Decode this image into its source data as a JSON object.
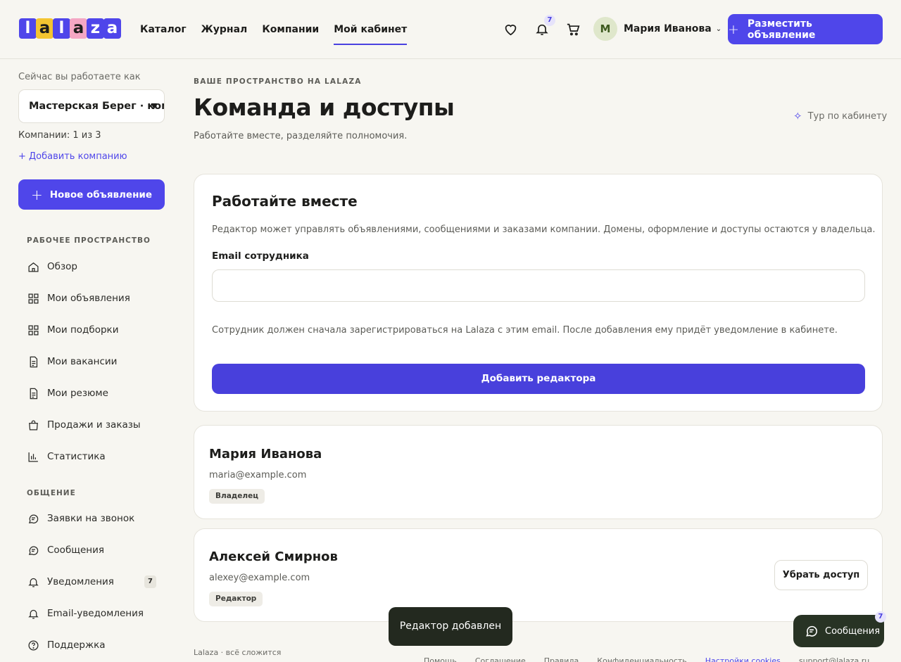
{
  "header": {
    "logo": [
      "l",
      "a",
      "l",
      "a",
      "z",
      "a"
    ],
    "nav": [
      "Каталог",
      "Журнал",
      "Компании",
      "Мой кабинет"
    ],
    "active_nav": "Мой кабинет",
    "notifications_count": "7",
    "user": {
      "initial": "М",
      "name": "Мария Иванова"
    },
    "post_button": "Разместить объявление"
  },
  "sidebar": {
    "caption": "Сейчас вы работаете как",
    "company_select": "Мастерская Берег · ком",
    "companies_count": "Компании: 1 из 3",
    "add_company": "+ Добавить компанию",
    "new_ad_button": "Новое объявление",
    "section_workspace": "РАБОЧЕЕ ПРОСТРАНСТВО",
    "workspace_items": [
      "Обзор",
      "Мои объявления",
      "Мои подборки",
      "Мои вакансии",
      "Мои резюме",
      "Продажи и заказы",
      "Статистика"
    ],
    "section_communication": "ОБЩЕНИЕ",
    "communication_items": [
      "Заявки на звонок",
      "Сообщения",
      "Уведомления",
      "Email-уведомления",
      "Поддержка"
    ],
    "notifications_badge": "7"
  },
  "main": {
    "eyebrow": "ВАШЕ ПРОСТРАНСТВО НА LALAZA",
    "title": "Команда и доступы",
    "subtitle": "Работайте вместе, разделяйте полномочия.",
    "tour": "Тур по кабинету",
    "invite_card": {
      "title": "Работайте вместе",
      "description": "Редактор может управлять объявлениями, сообщениями и заказами компании. Домены, оформление и доступы остаются у владельца.",
      "email_label": "Email сотрудника",
      "email_value": "",
      "hint": "Сотрудник должен сначала зарегистрироваться на Lalaza с этим email. После добавления ему придёт уведомление в кабинете.",
      "submit": "Добавить редактора"
    },
    "members": [
      {
        "name": "Мария Иванова",
        "email": "maria@example.com",
        "role": "Владелец"
      },
      {
        "name": "Алексей Смирнов",
        "email": "alexey@example.com",
        "role": "Редактор",
        "action": "Убрать доступ"
      }
    ]
  },
  "toast": "Редактор добавлен",
  "chat": {
    "label": "Сообщения",
    "badge": "7"
  },
  "footer": {
    "tagline": "Lalaza · всё сложится",
    "links": [
      "Помощь",
      "Соглашение",
      "Правила",
      "Конфиденциальность",
      "Настройки cookies",
      "support@lalaza.ru"
    ]
  },
  "colors": {
    "accent": "#4f46ea",
    "background": "#f7f6f1",
    "toast": "#23291f"
  }
}
